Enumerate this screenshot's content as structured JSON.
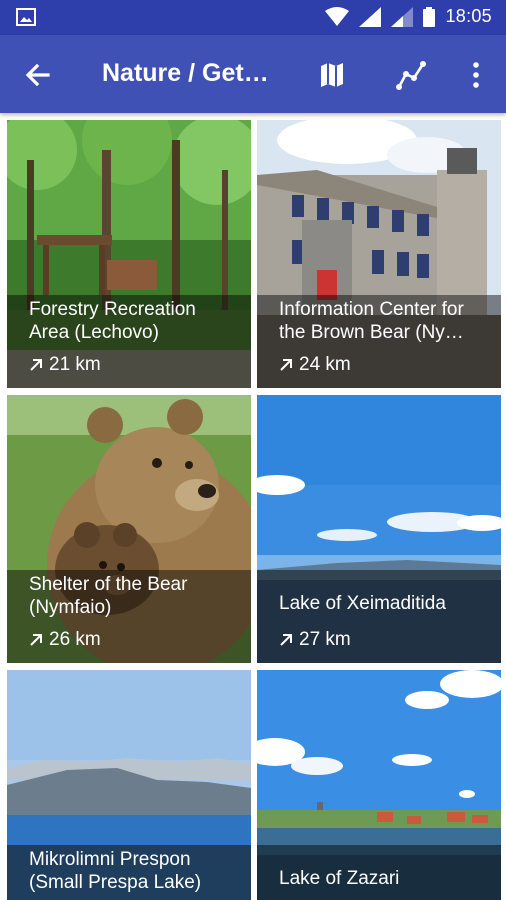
{
  "status_bar": {
    "time": "18:05"
  },
  "app_bar": {
    "title": "Nature / Get…",
    "back_icon": "arrow-left-icon",
    "actions": [
      "map-icon",
      "route-icon",
      "more-vert-icon"
    ]
  },
  "places": [
    {
      "name": "Forestry Recreation Area (Lechovo)",
      "distance": "21 km"
    },
    {
      "name": "Information Center for the Brown Bear (Ny…",
      "distance": "24 km"
    },
    {
      "name": "Shelter of the Bear (Nymfaio)",
      "distance": "26 km"
    },
    {
      "name": "Lake of Xeimaditida",
      "distance": "27 km"
    },
    {
      "name": "Mikrolimni Prespon (Small Prespa Lake)",
      "distance": ""
    },
    {
      "name": "Lake of Zazari",
      "distance": ""
    }
  ],
  "colors": {
    "status_bar": "#2e3eab",
    "app_bar": "#3f51b5"
  }
}
